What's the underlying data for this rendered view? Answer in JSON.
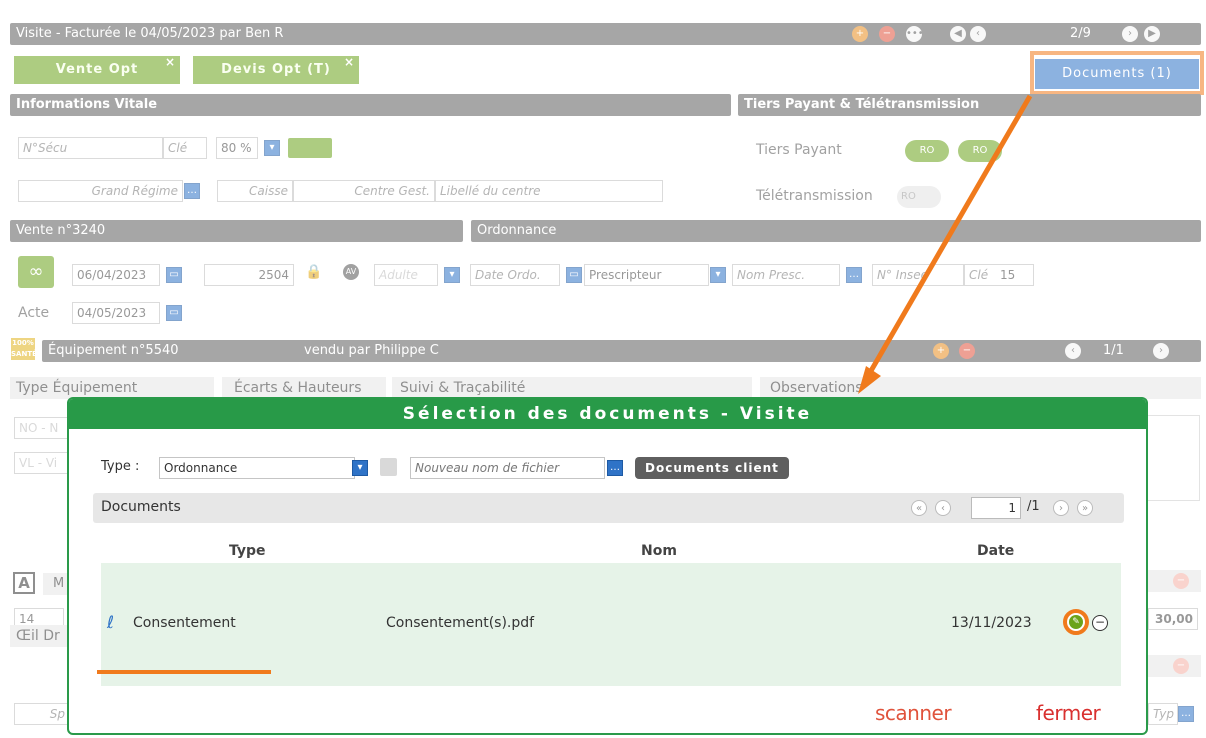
{
  "visit_header": {
    "title": "Visite - Facturée le 04/05/2023 par Ben R",
    "pager": "2/9"
  },
  "tabs": [
    {
      "label": "Vente Opt"
    },
    {
      "label": "Devis Opt (T)"
    }
  ],
  "documents_button": "Documents (1)",
  "vitale": {
    "header": "Informations Vitale",
    "nsecu_placeholder": "N°Sécu",
    "cle_placeholder": "Clé",
    "rate": "80 %",
    "grand_regime": "Grand Régime",
    "caisse": "Caisse",
    "centre_gest": "Centre Gest.",
    "libelle": "Libellé du centre"
  },
  "tiers": {
    "header": "Tiers Payant & Télétransmission",
    "tiers_payant": "Tiers Payant",
    "teletransmission": "Télétransmission",
    "toggle_label": "RO"
  },
  "vente": {
    "header": "Vente n°3240",
    "date": "06/04/2023",
    "number": "2504",
    "av": "AV",
    "adulte": "Adulte",
    "acte_label": "Acte",
    "acte_date": "04/05/2023"
  },
  "ordonnance": {
    "header": "Ordonnance",
    "date_ordo": "Date Ordo.",
    "prescripteur": "Prescripteur",
    "nom_presc": "Nom Presc.",
    "n_insee": "N° Insee",
    "cle": "Clé",
    "cle_value": "15"
  },
  "equipement": {
    "badge": "100% SANTÉ",
    "header": "Équipement n°5540",
    "sold_by": "vendu par Philippe C",
    "pager": "1/1",
    "tabs": [
      "Type Équipement",
      "Écarts & Hauteurs",
      "Suivi & Traçabilité",
      "Observations"
    ]
  },
  "left_fragments": {
    "no": "NO - N",
    "vl": "VL - Vi",
    "a_btn": "A",
    "m": "M",
    "value_14": "14",
    "oeil": "Œil Dr",
    "sp": "Sp",
    "amount": "30,00",
    "typ": "Typ"
  },
  "modal": {
    "title": "Sélection des documents - Visite",
    "type_label": "Type :",
    "type_value": "Ordonnance",
    "filename_placeholder": "Nouveau nom de fichier",
    "client_docs_button": "Documents client",
    "list_title": "Documents",
    "page_current": "1",
    "page_total": "/1",
    "columns": {
      "type": "Type",
      "nom": "Nom",
      "date": "Date"
    },
    "rows": [
      {
        "type": "Consentement",
        "nom": "Consentement(s).pdf",
        "date": "13/11/2023"
      }
    ],
    "scanner": "scanner",
    "fermer": "fermer"
  },
  "colors": {
    "header_grey": "#5e5e5e",
    "tab_green": "#6ba31a",
    "modal_green": "#289a48",
    "accent_blue": "#2f73c7",
    "highlight_orange": "#f07a1c",
    "action_red": "#e0533c"
  }
}
